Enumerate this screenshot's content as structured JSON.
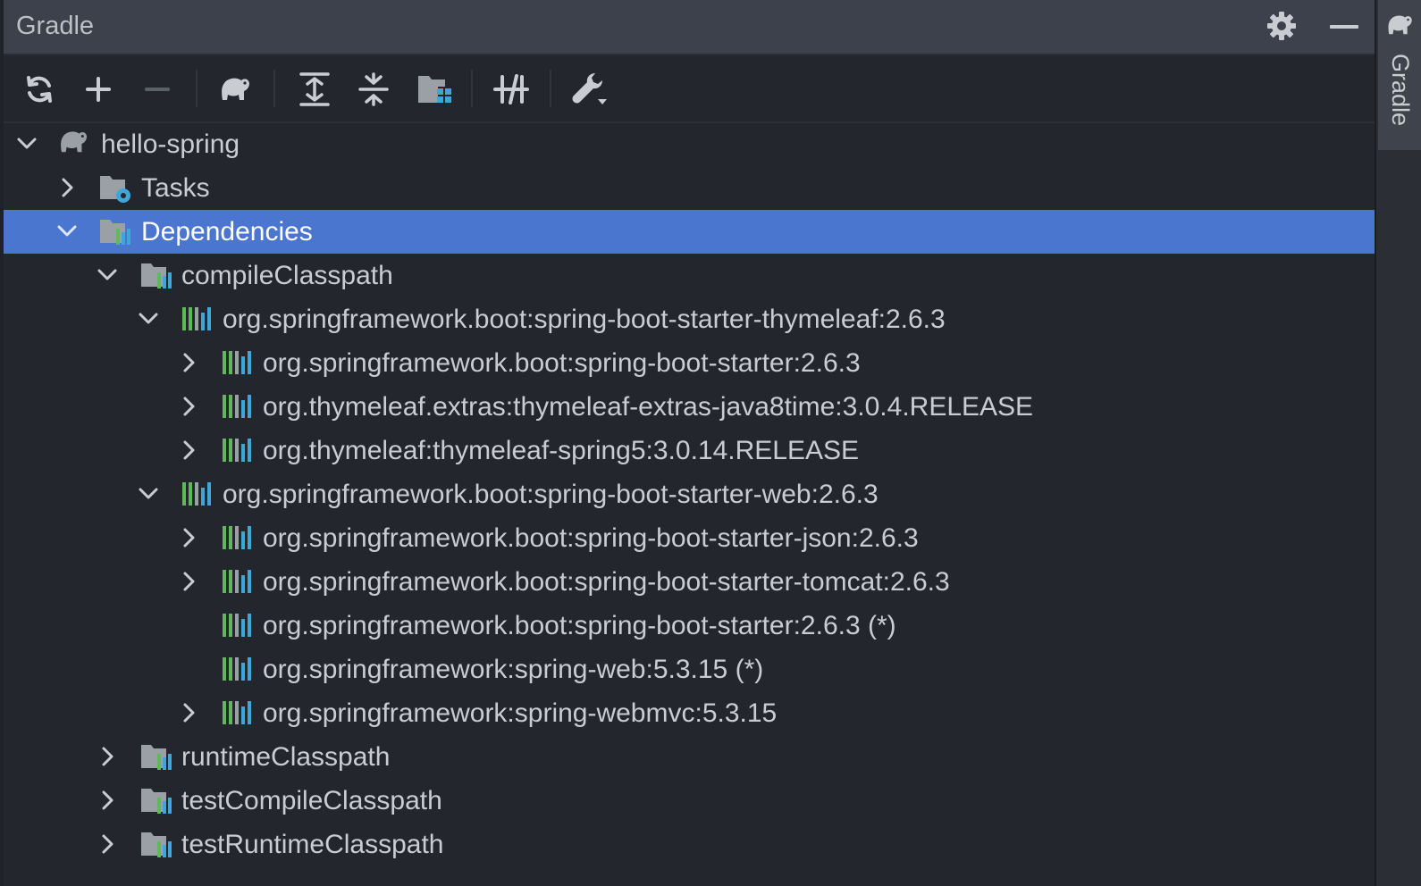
{
  "panel": {
    "title": "Gradle",
    "header_icons": [
      "gear-icon",
      "minimize-icon"
    ]
  },
  "toolbar": {
    "buttons": [
      {
        "name": "reload-all-gradle-projects",
        "icon": "refresh-icon"
      },
      {
        "name": "link-gradle-project",
        "icon": "plus-icon"
      },
      {
        "name": "unlink-gradle-project",
        "icon": "minus-icon"
      },
      {
        "name": "execute-gradle-task",
        "icon": "elephant-icon"
      },
      {
        "name": "expand-all",
        "icon": "expand-all-icon"
      },
      {
        "name": "collapse-all",
        "icon": "collapse-all-icon"
      },
      {
        "name": "analyze-dependencies",
        "icon": "dependencies-icon"
      },
      {
        "name": "toggle-offline-mode",
        "icon": "offline-icon"
      },
      {
        "name": "build-tool-settings",
        "icon": "wrench-icon"
      }
    ]
  },
  "tree": [
    {
      "label": "hello-spring",
      "icon": "elephant-icon",
      "depth": 0,
      "state": "expanded",
      "selected": false
    },
    {
      "label": "Tasks",
      "icon": "tasks-folder-icon",
      "depth": 1,
      "state": "collapsed",
      "selected": false
    },
    {
      "label": "Dependencies",
      "icon": "dependencies-folder-icon",
      "depth": 1,
      "state": "expanded",
      "selected": true
    },
    {
      "label": "compileClasspath",
      "icon": "dependencies-folder-icon",
      "depth": 2,
      "state": "expanded",
      "selected": false
    },
    {
      "label": "org.springframework.boot:spring-boot-starter-thymeleaf:2.6.3",
      "icon": "library-icon",
      "depth": 3,
      "state": "expanded",
      "selected": false
    },
    {
      "label": "org.springframework.boot:spring-boot-starter:2.6.3",
      "icon": "library-icon",
      "depth": 4,
      "state": "collapsed",
      "selected": false
    },
    {
      "label": "org.thymeleaf.extras:thymeleaf-extras-java8time:3.0.4.RELEASE",
      "icon": "library-icon",
      "depth": 4,
      "state": "collapsed",
      "selected": false
    },
    {
      "label": "org.thymeleaf:thymeleaf-spring5:3.0.14.RELEASE",
      "icon": "library-icon",
      "depth": 4,
      "state": "collapsed",
      "selected": false
    },
    {
      "label": "org.springframework.boot:spring-boot-starter-web:2.6.3",
      "icon": "library-icon",
      "depth": 3,
      "state": "expanded",
      "selected": false
    },
    {
      "label": "org.springframework.boot:spring-boot-starter-json:2.6.3",
      "icon": "library-icon",
      "depth": 4,
      "state": "collapsed",
      "selected": false
    },
    {
      "label": "org.springframework.boot:spring-boot-starter-tomcat:2.6.3",
      "icon": "library-icon",
      "depth": 4,
      "state": "collapsed",
      "selected": false
    },
    {
      "label": "org.springframework.boot:spring-boot-starter:2.6.3 (*)",
      "icon": "library-icon",
      "depth": 4,
      "state": "leaf",
      "selected": false
    },
    {
      "label": "org.springframework:spring-web:5.3.15 (*)",
      "icon": "library-icon",
      "depth": 4,
      "state": "leaf",
      "selected": false
    },
    {
      "label": "org.springframework:spring-webmvc:5.3.15",
      "icon": "library-icon",
      "depth": 4,
      "state": "collapsed",
      "selected": false
    },
    {
      "label": "runtimeClasspath",
      "icon": "dependencies-folder-icon",
      "depth": 2,
      "state": "collapsed",
      "selected": false
    },
    {
      "label": "testCompileClasspath",
      "icon": "dependencies-folder-icon",
      "depth": 2,
      "state": "collapsed",
      "selected": false
    },
    {
      "label": "testRuntimeClasspath",
      "icon": "dependencies-folder-icon",
      "depth": 2,
      "state": "collapsed",
      "selected": false
    }
  ],
  "side_tab": {
    "label": "Gradle",
    "icon": "elephant-icon"
  },
  "colors": {
    "background": "#23262d",
    "header": "#3c414b",
    "selection": "#4b76cf",
    "text": "#c9cdd2",
    "lib_green": "#5fb85a",
    "lib_blue": "#3fa6d9",
    "lib_gray": "#9aa0a6"
  }
}
